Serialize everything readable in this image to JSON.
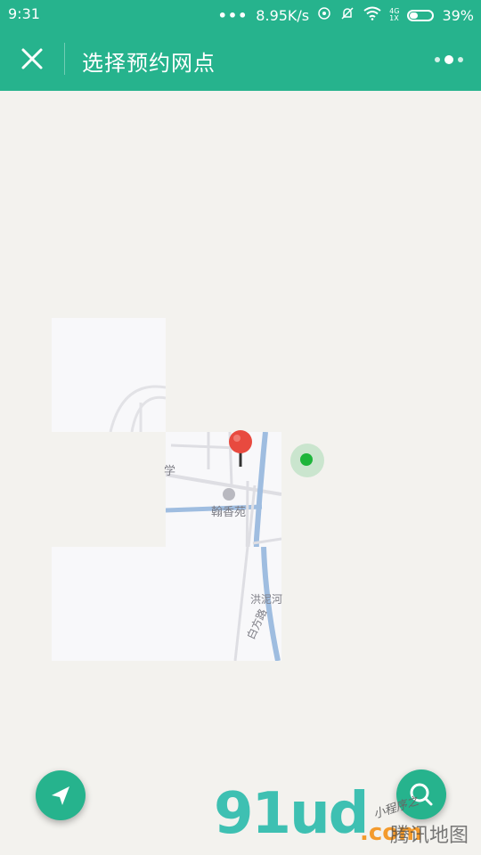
{
  "status_bar": {
    "time": "9:31",
    "dots": "•••",
    "network_speed": "8.95K/s",
    "signal_top": "4G",
    "signal_bottom": "1X",
    "battery": "39%"
  },
  "header": {
    "title": "选择预约网点",
    "close_icon": "close-icon",
    "more_icon": "more-icon"
  },
  "map": {
    "labels": {
      "poi": "翰香苑",
      "river": "洪泥河",
      "road": "白方路",
      "left_fragment": "学"
    }
  },
  "controls": {
    "locate_icon": "navigation-arrow-icon",
    "search_icon": "search-icon"
  },
  "watermark": {
    "logo": "91ud",
    "suffix": ".com",
    "handwriting": "小程序之",
    "provider": "腾讯地图"
  },
  "colors": {
    "accent": "#26b38d",
    "map_background": "#f3f2ee",
    "pin": "#e84a3f",
    "location_dot": "#1db53a"
  }
}
